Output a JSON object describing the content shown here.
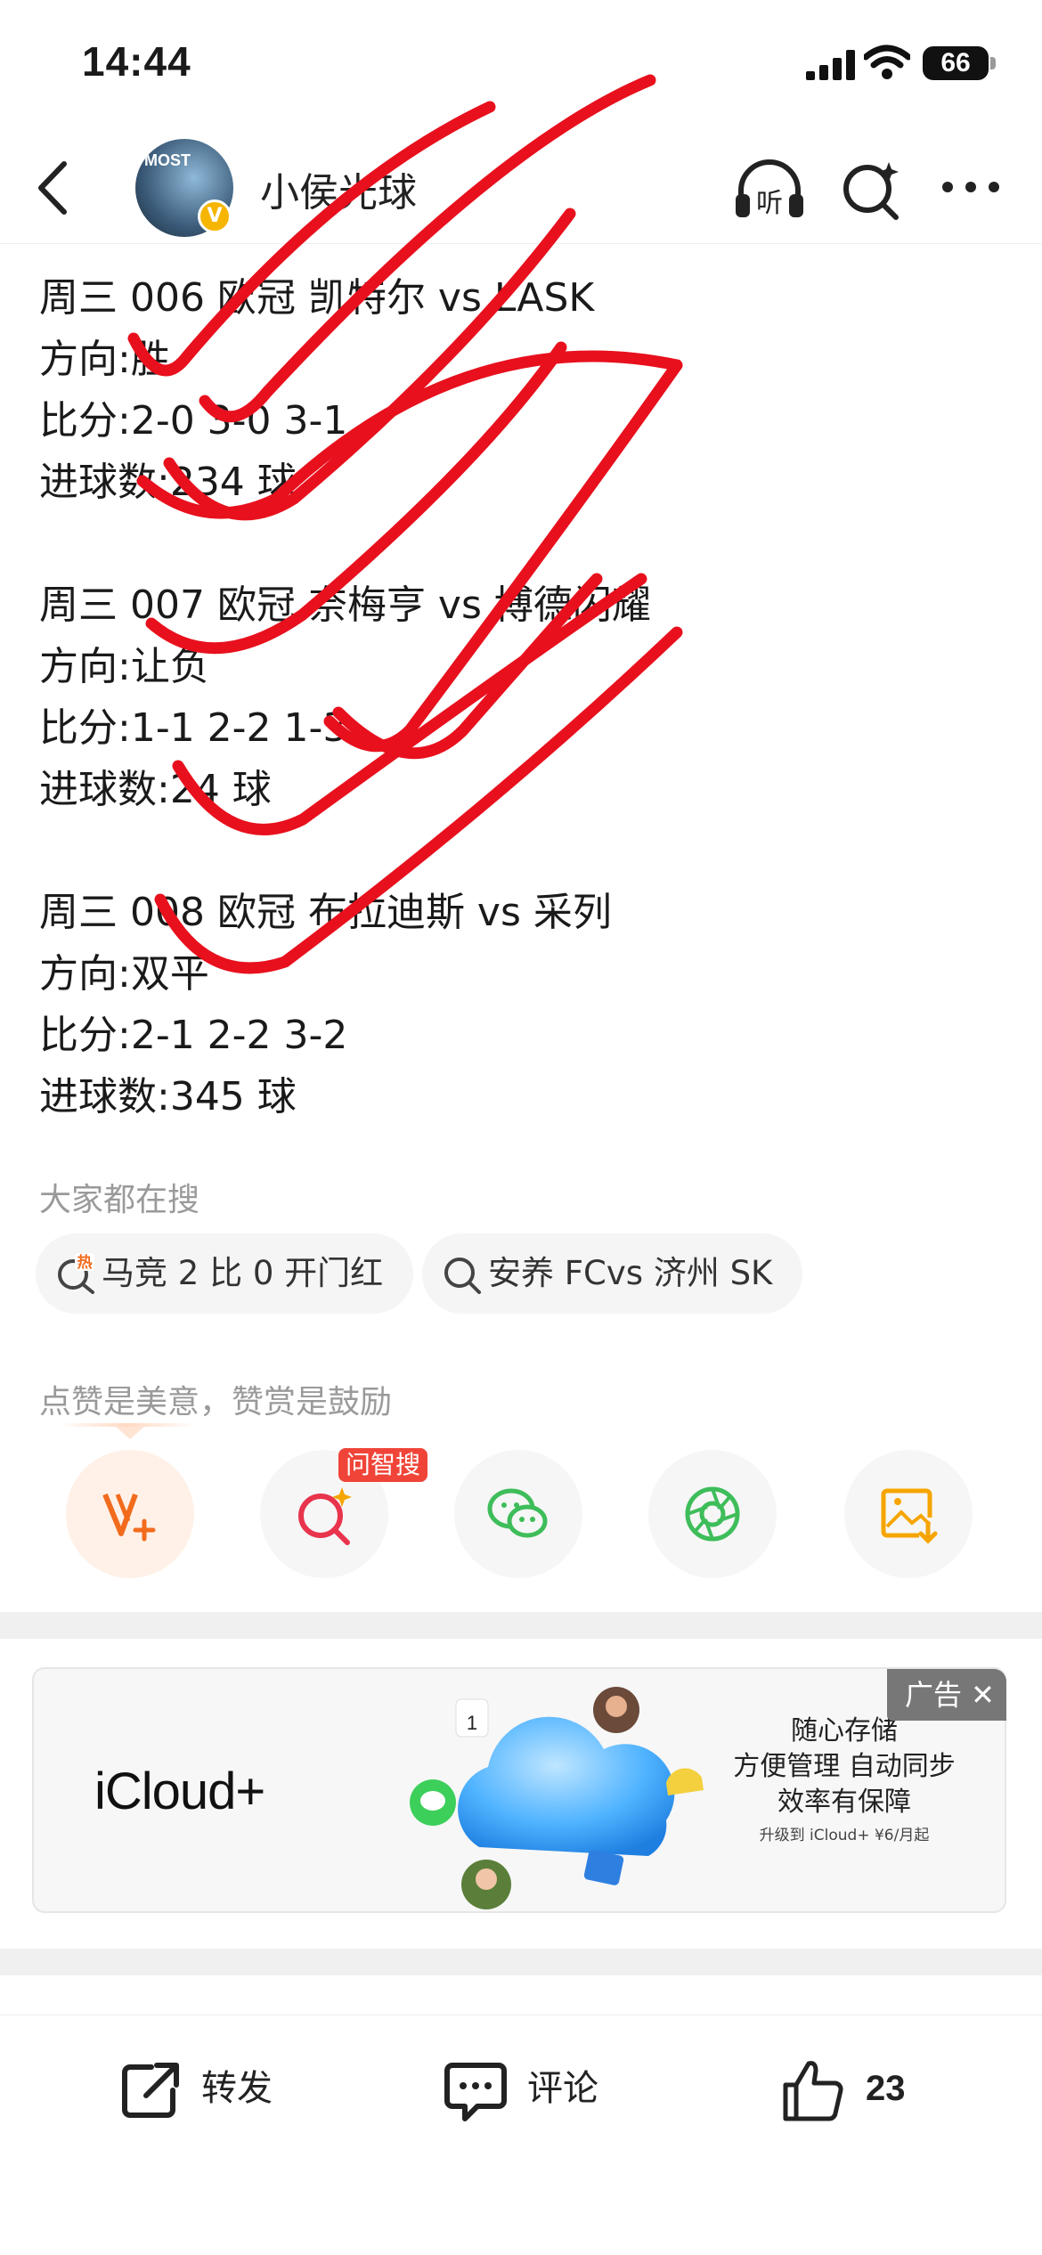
{
  "status_bar": {
    "time": "14:44",
    "battery": "66"
  },
  "header": {
    "author_name": "小侯光球",
    "avatar_text": "MOST"
  },
  "article": {
    "blocks": [
      {
        "title": "周三 006 欧冠 凯特尔 vs LASK",
        "direction": "方向:胜",
        "score": "比分:2-0  3-0  3-1",
        "goals": "进球数:234 球"
      },
      {
        "title": "周三 007 欧冠 奈梅亨 vs 博德闪耀",
        "direction": "方向:让负",
        "score": "比分:1-1   2-2   1-3",
        "goals": "进球数:24 球"
      },
      {
        "title": "周三 008 欧冠 布拉迪斯 vs 采列",
        "direction": "方向:双平",
        "score": "比分:2-1  2-2  3-2",
        "goals": "进球数:345 球"
      }
    ]
  },
  "searches": {
    "title": "大家都在搜",
    "chips": [
      "马竞 2 比 0 开门红",
      "安养 FCvs 济州 SK"
    ],
    "hot_badge": "热"
  },
  "share": {
    "tip": "点赞是美意，赞赏是鼓励",
    "ai_badge": "问智搜",
    "icons": [
      "reward-icon",
      "ai-search-icon",
      "wechat-icon",
      "moments-icon",
      "save-image-icon"
    ]
  },
  "ad": {
    "brand": "iCloud+",
    "headline_1": "随心存储",
    "headline_2": "方便管理 自动同步",
    "headline_3": "效率有保障",
    "offer": "升级到 iCloud+ ¥6/月起",
    "tag": "广告 ✕",
    "calendar_day": "1"
  },
  "bottom_bar": {
    "repost": "转发",
    "comment": "评论",
    "likes": "23"
  },
  "colors": {
    "scribble": "#e8101d",
    "accent": "#f26b1d",
    "wechat": "#3ebd5a",
    "gold": "#f6b500"
  }
}
